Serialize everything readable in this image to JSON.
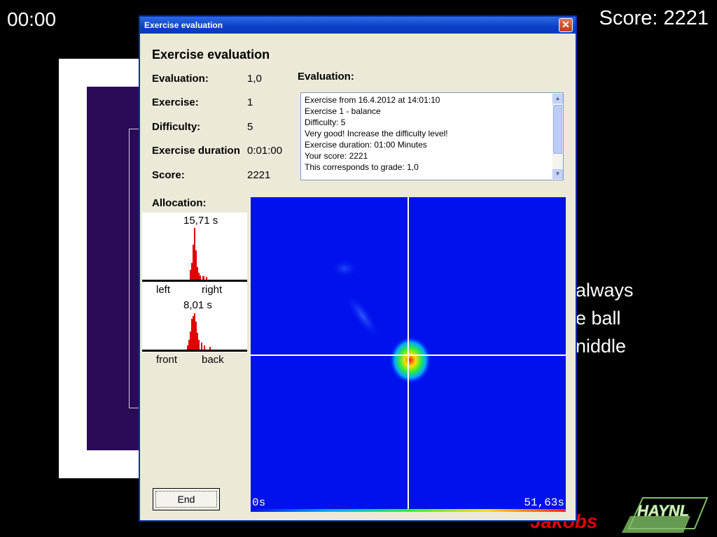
{
  "hud": {
    "timer": "00:00",
    "score": "Score: 2221"
  },
  "background_instructions": [
    "always",
    "e ball",
    "niddle"
  ],
  "logos": {
    "jakobs": "Jakobs",
    "haynl": "HAYNL"
  },
  "dialog": {
    "title": "Exercise evaluation",
    "heading": "Exercise evaluation",
    "fields": [
      {
        "label": "Evaluation:",
        "value": "1,0"
      },
      {
        "label": "Exercise:",
        "value": "1"
      },
      {
        "label": "Difficulty:",
        "value": "5"
      },
      {
        "label": "Exercise duration",
        "value": "0:01:00"
      },
      {
        "label": "Score:",
        "value": "2221"
      }
    ],
    "evaluation_label": "Evaluation:",
    "evaluation_lines": [
      "Exercise from 16.4.2012 at 14:01:10",
      "Exercise 1 - balance",
      "Difficulty: 5",
      "Very good! Increase the difficulty level!",
      "Exercise duration: 01:00  Minutes",
      "Your score: 2221",
      "This corresponds to grade: 1,0"
    ],
    "allocation_label": "Allocation:",
    "histograms": [
      {
        "value": "15,71 s",
        "left": "left",
        "right": "right"
      },
      {
        "value": "8,01 s",
        "left": "front",
        "right": "back"
      }
    ],
    "heatmap": {
      "min_label": "0s",
      "max_label": "51,63s"
    },
    "end_button": "End"
  },
  "colors": {
    "titlebar": "#0a3fc6",
    "dialog_bg": "#ece9d8",
    "heatmap_bg": "#0011ee",
    "histogram": "#e00000"
  }
}
